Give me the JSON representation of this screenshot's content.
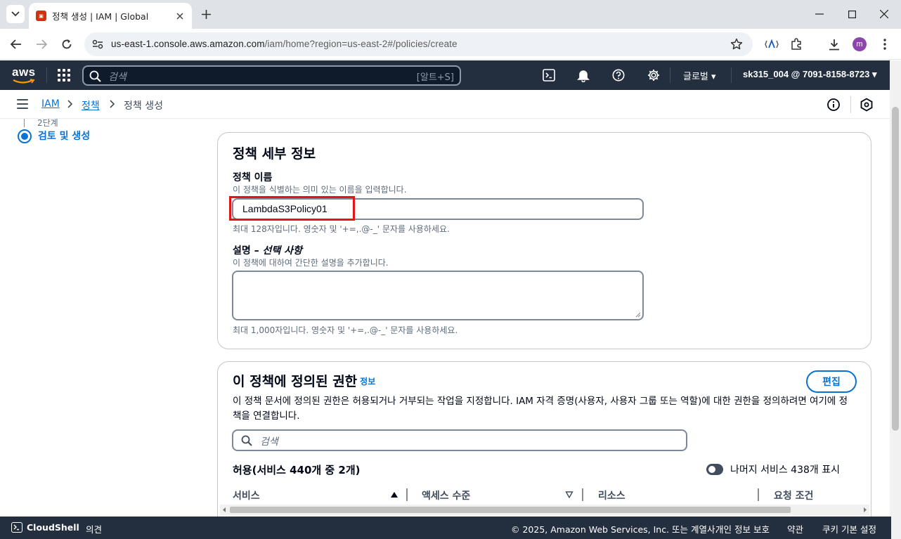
{
  "browser": {
    "tab_title": "정책 생성 | IAM | Global",
    "url_host": "us-east-1.console.aws.amazon.com",
    "url_path": "/iam/home?region=us-east-2#/policies/create",
    "profile_initial": "m"
  },
  "aws_header": {
    "search_placeholder": "검색",
    "search_shortcut": "[알트+S]",
    "region": "글로벌 ▾",
    "account": "sk315_004 @ 7091-8158-8723 ▾"
  },
  "breadcrumb": {
    "items": [
      "IAM",
      "정책",
      "정책 생성"
    ]
  },
  "steps": {
    "prev_label": "2단계",
    "current_label": "검토 및 생성"
  },
  "policy_details": {
    "title": "정책 세부 정보",
    "name_label": "정책 이름",
    "name_desc": "이 정책을 식별하는 의미 있는 이름을 입력합니다.",
    "name_value": "LambdaS3Policy01",
    "name_constraint": "최대 128자입니다. 영숫자 및 '+=,.@-_' 문자를 사용하세요.",
    "desc_label": "설명 – ",
    "desc_optional": "선택 사항",
    "desc_desc": "이 정책에 대하여 간단한 설명을 추가합니다.",
    "desc_value": "",
    "desc_constraint": "최대 1,000자입니다. 영숫자 및 '+=,.@-_' 문자를 사용하세요."
  },
  "permissions": {
    "title": "이 정책에 정의된 권한",
    "info_link": "정보",
    "edit_button": "편집",
    "description": "이 정책 문서에 정의된 권한은 허용되거나 거부되는 작업을 지정합니다. IAM 자격 증명(사용자, 사용자 그룹 또는 역할)에 대한 권한을 정의하려면 여기에 정책을 연결합니다.",
    "search_placeholder": "검색",
    "allow_title": "허용(서비스 440개 중 2개)",
    "toggle_label": "나머지 서비스 438개 표시",
    "toggle_on": false,
    "columns": [
      "서비스",
      "액세스 수준",
      "리소스",
      "요청 조건"
    ]
  },
  "footer": {
    "cloudshell": "CloudShell",
    "feedback": "의견",
    "copyright": "© 2025, Amazon Web Services, Inc. 또는 계열사.",
    "privacy": "개인 정보 보호",
    "terms": "약관",
    "cookies": "쿠키 기본 설정"
  },
  "colors": {
    "aws_header_bg": "#232f3e",
    "link_blue": "#0972d3",
    "highlight_red": "#e5141a"
  }
}
